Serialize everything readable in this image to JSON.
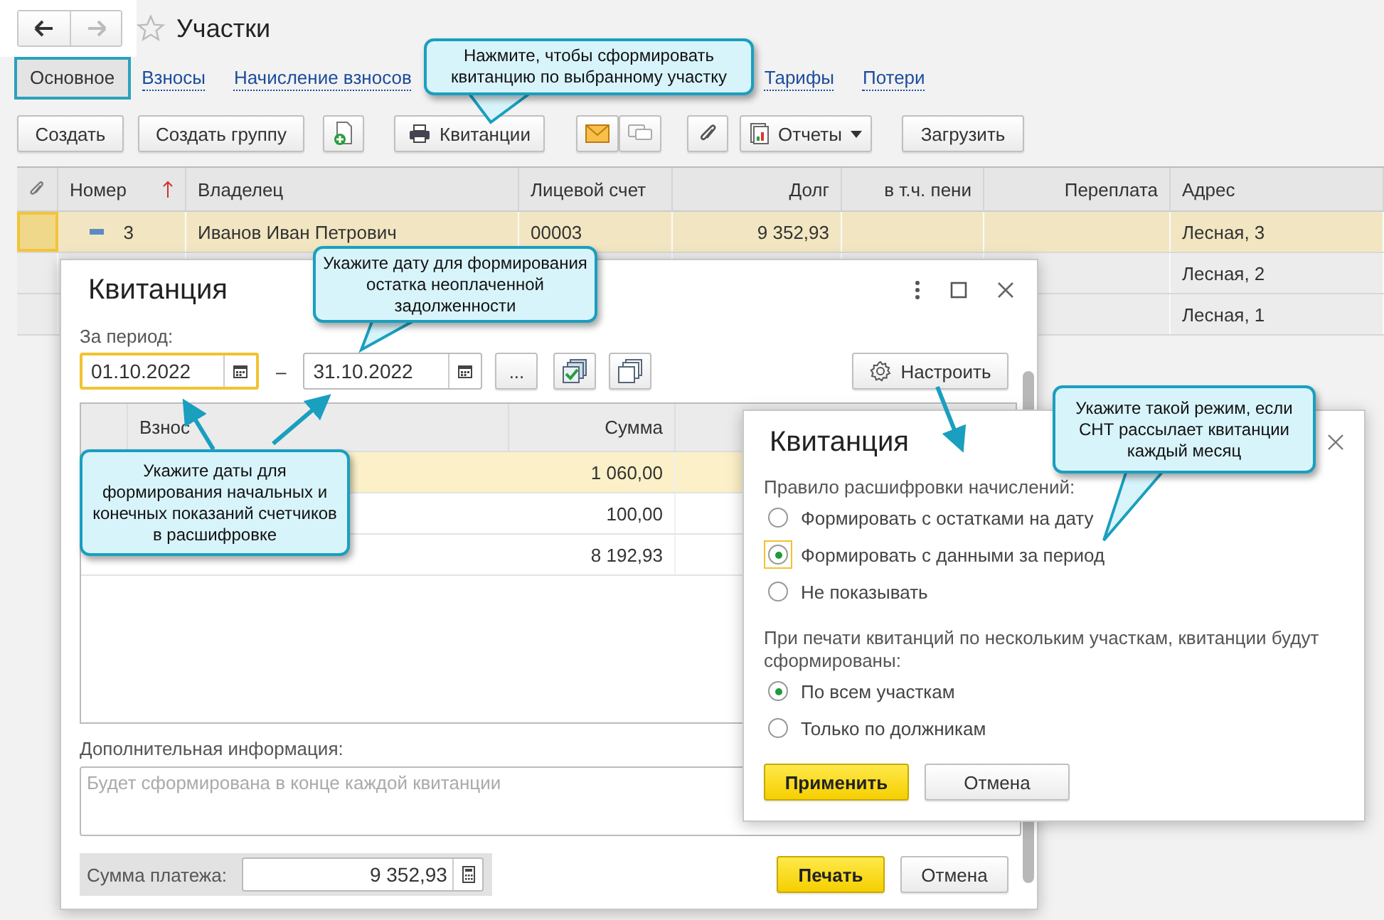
{
  "title": "Участки",
  "tabs": [
    {
      "label": "Основное",
      "selected": true
    },
    {
      "label": "Взносы",
      "selected": false
    },
    {
      "label": "Начисление взносов",
      "selected": false
    },
    {
      "label": "Тарифы",
      "selected": false
    },
    {
      "label": "Потери",
      "selected": false
    }
  ],
  "toolbar": {
    "create": "Создать",
    "create_group": "Создать группу",
    "receipts": "Квитанции",
    "reports": "Отчеты",
    "load": "Загрузить"
  },
  "table": {
    "columns": [
      "Номер",
      "Владелец",
      "Лицевой счет",
      "Долг",
      "в т.ч. пени",
      "Переплата",
      "Адрес"
    ],
    "rows": [
      {
        "number": "3",
        "owner": "Иванов Иван Петрович",
        "account": "00003",
        "debt": "9 352,93",
        "address": "Лесная, 3",
        "selected": true
      },
      {
        "address": "Лесная, 2",
        "selected": false
      },
      {
        "address": "Лесная, 1",
        "selected": false
      }
    ]
  },
  "receipt_dialog": {
    "title": "Квитанция",
    "period_label": "За период:",
    "date_from": {
      "value": "01.10.2022",
      "focused": true
    },
    "dash": "–",
    "date_to": {
      "value": "31.10.2022",
      "focused": false
    },
    "more_button": "...",
    "settings_button": "Настроить",
    "columns": [
      "Взнос",
      "Сумма"
    ],
    "rows": [
      {
        "amount": "1 060,00",
        "selected": true
      },
      {
        "amount": "100,00",
        "selected": false
      },
      {
        "amount": "8 192,93",
        "selected": false
      }
    ],
    "info_label": "Дополнительная информация:",
    "info_placeholder": "Будет сформирована в конце каждой квитанции",
    "sum_label": "Сумма платежа:",
    "sum_value": "9 352,93",
    "print_button": "Печать",
    "cancel_button": "Отмена"
  },
  "settings_dialog": {
    "title": "Квитанция",
    "rule_label": "Правило расшифровки начислений:",
    "rule_options": [
      {
        "label": "Формировать с остатками на дату",
        "selected": false,
        "focused": false
      },
      {
        "label": "Формировать с данными за период",
        "selected": true,
        "focused": true
      },
      {
        "label": "Не показывать",
        "selected": false,
        "focused": false
      }
    ],
    "print_label": "При печати квитанций по нескольким участкам, квитанции будут сформированы:",
    "print_options": [
      {
        "label": "По всем участкам",
        "selected": true
      },
      {
        "label": "Только по должникам",
        "selected": false
      }
    ],
    "apply_button": "Применить",
    "cancel_button": "Отмена"
  },
  "callouts": [
    {
      "text": "Нажмите, чтобы сформировать квитанцию по выбранному участку"
    },
    {
      "text": "Укажите дату для формирования остатка неоплаченной задолженности"
    },
    {
      "text": "Укажите даты для формирования начальных и конечных показаний счетчиков в расшифровке"
    },
    {
      "text": "Укажите такой режим, если СНТ рассылает квитанции каждый месяц"
    }
  ]
}
